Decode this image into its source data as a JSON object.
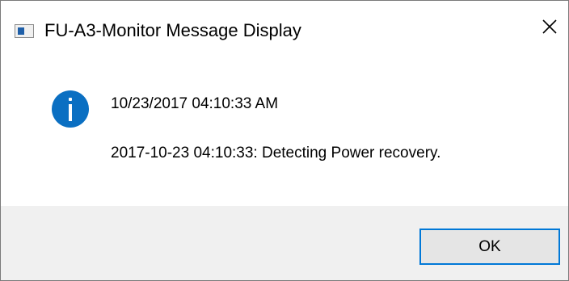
{
  "window": {
    "title": "FU-A3-Monitor Message Display",
    "close_glyph": "✕",
    "app_icon": "window-app-icon",
    "close_icon": "close-icon"
  },
  "message": {
    "icon": "info-icon",
    "icon_color": "#0a6fc2",
    "icon_glyph": "i",
    "line1": "10/23/2017 04:10:33 AM",
    "line2": "2017-10-23 04:10:33: Detecting Power recovery."
  },
  "buttons": {
    "ok_label": "OK",
    "accent": "#0078d7"
  }
}
